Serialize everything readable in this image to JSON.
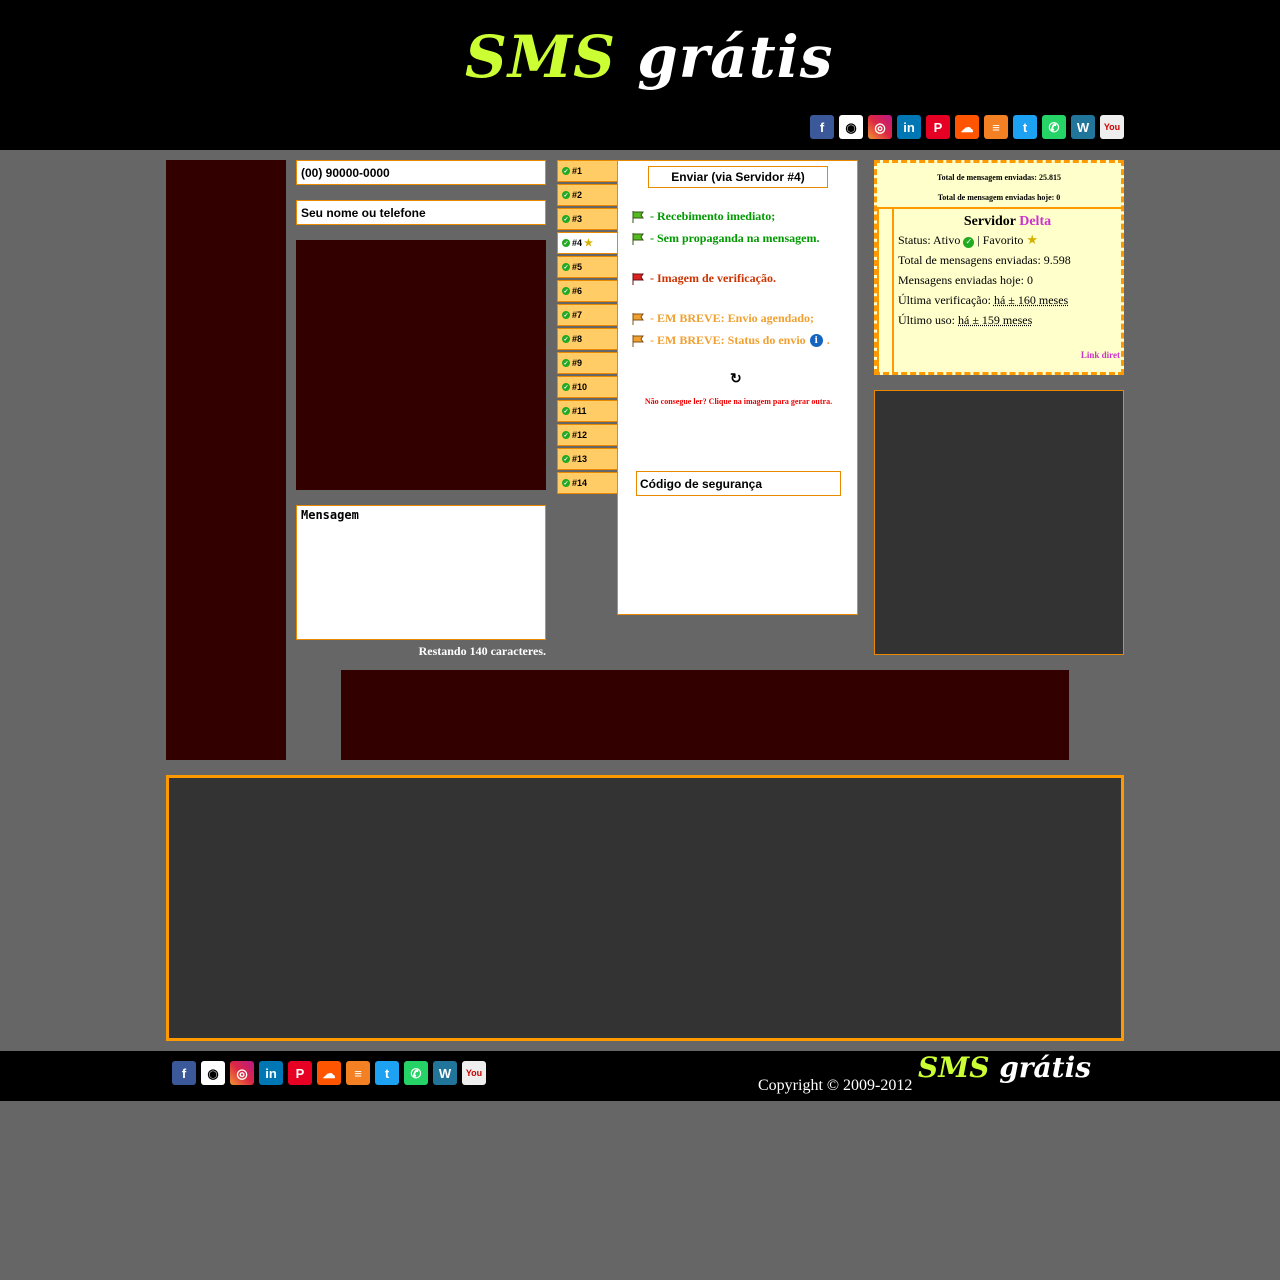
{
  "header": {
    "logo": {
      "sms": "SMS",
      "gratis": "grátis"
    },
    "social": [
      {
        "name": "facebook-icon",
        "glyph": "f",
        "cls": "fb"
      },
      {
        "name": "github-icon",
        "glyph": "◉",
        "cls": "gh"
      },
      {
        "name": "instagram-icon",
        "glyph": "◎",
        "cls": "ig"
      },
      {
        "name": "linkedin-icon",
        "glyph": "in",
        "cls": "li"
      },
      {
        "name": "pinterest-icon",
        "glyph": "P",
        "cls": "pi"
      },
      {
        "name": "soundcloud-icon",
        "glyph": "☁",
        "cls": "sc"
      },
      {
        "name": "stackoverflow-icon",
        "glyph": "≡",
        "cls": "so"
      },
      {
        "name": "twitter-icon",
        "glyph": "t",
        "cls": "tw"
      },
      {
        "name": "whatsapp-icon",
        "glyph": "✆",
        "cls": "wa"
      },
      {
        "name": "wordpress-icon",
        "glyph": "W",
        "cls": "wp"
      },
      {
        "name": "youtube-icon",
        "glyph": "You",
        "cls": "yt"
      }
    ]
  },
  "form": {
    "phone_placeholder": "(00) 90000-0000",
    "name_placeholder": "Seu nome ou telefone",
    "message_placeholder": "Mensagem",
    "remaining": "Restando 140 caracteres."
  },
  "tabs": [
    "#1",
    "#2",
    "#3",
    "#4",
    "#5",
    "#6",
    "#7",
    "#8",
    "#9",
    "#10",
    "#11",
    "#12",
    "#13",
    "#14"
  ],
  "active_tab": "#4",
  "panel": {
    "send_label": "Enviar (via Servidor #4)",
    "features": {
      "f1": "- Recebimento imediato;",
      "f2": "- Sem propaganda na mensagem.",
      "f3": "- Imagem de verificação.",
      "f4": "- EM BREVE: Envio agendado;",
      "f5": "- EM BREVE: Status do envio",
      "f5_suffix": "."
    },
    "captcha_hint": "Não consegue ler? Clique na imagem para gerar outra.",
    "code_placeholder": "Código de segurança"
  },
  "stats": {
    "total_sent": "Total de mensagem enviadas: 25.815",
    "total_today": "Total de mensagem enviadas hoje: 0",
    "server_label": "Servidor",
    "server_name": "Delta",
    "status_label": "Status: Ativo",
    "favorite_label": "| Favorito",
    "server_total": "Total de mensagens enviadas: 9.598",
    "server_today": "Mensagens enviadas hoje: 0",
    "last_check_label": "Última verificação:",
    "last_check_value": "há ± 160 meses",
    "last_use_label": "Último uso:",
    "last_use_value": "há ± 159 meses",
    "link_direct": "Link diret"
  },
  "footer": {
    "copyright": "Copyright © 2009-2012",
    "logo": {
      "sms": "SMS",
      "gratis": "grátis"
    }
  },
  "colors": {
    "accent": "#ff9900",
    "logo_green": "#ccff33",
    "server_name": "#cc33cc"
  }
}
